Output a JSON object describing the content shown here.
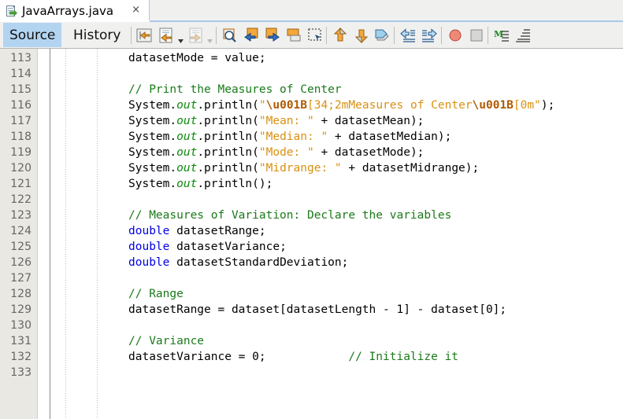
{
  "window": {
    "file_tab": {
      "label": "JavaArrays.java",
      "icon": "java-file-icon",
      "close_label": "×"
    }
  },
  "view_tabs": [
    {
      "id": "source",
      "label": "Source",
      "active": true
    },
    {
      "id": "history",
      "label": "History",
      "active": false
    }
  ],
  "toolbar": {
    "buttons": [
      {
        "name": "last-edit-position-icon",
        "title": "Last Edit Position"
      },
      {
        "name": "back-navigation-icon",
        "title": "Back"
      },
      {
        "name": "forward-navigation-icon",
        "title": "Forward"
      },
      {
        "name": "find-selection-icon",
        "title": "Find Selection"
      },
      {
        "name": "find-previous-icon",
        "title": "Find Previous Occurrence"
      },
      {
        "name": "find-next-icon",
        "title": "Find Next Occurrence"
      },
      {
        "name": "toggle-highlight-icon",
        "title": "Toggle Highlight Search"
      },
      {
        "name": "toggle-rectangular-selection-icon",
        "title": "Toggle Rectangular Selection"
      },
      {
        "name": "previous-bookmark-icon",
        "title": "Previous Bookmark"
      },
      {
        "name": "next-bookmark-icon",
        "title": "Next Bookmark"
      },
      {
        "name": "toggle-bookmark-icon",
        "title": "Toggle Bookmark"
      },
      {
        "name": "shift-line-left-icon",
        "title": "Shift Line Left"
      },
      {
        "name": "shift-line-right-icon",
        "title": "Shift Line Right"
      },
      {
        "name": "toggle-breakpoint-icon",
        "title": "Toggle Breakpoint"
      },
      {
        "name": "stop-icon",
        "title": "Stop"
      },
      {
        "name": "inspect-members-icon",
        "title": "Inspect Members"
      },
      {
        "name": "inspect-hierarchy-icon",
        "title": "Inspect Hierarchy"
      }
    ]
  },
  "editor": {
    "first_line_number": 113,
    "language": "java",
    "colors": {
      "keyword": "#0000e6",
      "comment": "#1a7a1a",
      "string": "#d99011",
      "escape": "#b05a00",
      "static_field": "#0c8a0c",
      "plain": "#000000",
      "gutter_bg": "#e9e8e2",
      "editor_bg": "#ffffff",
      "accent": "#b3d4f0"
    },
    "lines": [
      {
        "n": 113,
        "tokens": [
          {
            "t": "plain",
            "s": "            datasetMode = value;"
          }
        ]
      },
      {
        "n": 114,
        "tokens": []
      },
      {
        "n": 115,
        "tokens": [
          {
            "t": "comment",
            "s": "            // Print the Measures of Center"
          }
        ]
      },
      {
        "n": 116,
        "tokens": [
          {
            "t": "plain",
            "s": "            System."
          },
          {
            "t": "field",
            "s": "out"
          },
          {
            "t": "plain",
            "s": ".println("
          },
          {
            "t": "string",
            "s": "\""
          },
          {
            "t": "escape",
            "s": "\\u001B"
          },
          {
            "t": "string",
            "s": "[34;2mMeasures of Center"
          },
          {
            "t": "escape",
            "s": "\\u001B"
          },
          {
            "t": "string",
            "s": "[0m\""
          },
          {
            "t": "plain",
            "s": ");"
          }
        ]
      },
      {
        "n": 117,
        "tokens": [
          {
            "t": "plain",
            "s": "            System."
          },
          {
            "t": "field",
            "s": "out"
          },
          {
            "t": "plain",
            "s": ".println("
          },
          {
            "t": "string",
            "s": "\"Mean: \""
          },
          {
            "t": "plain",
            "s": " + datasetMean);"
          }
        ]
      },
      {
        "n": 118,
        "tokens": [
          {
            "t": "plain",
            "s": "            System."
          },
          {
            "t": "field",
            "s": "out"
          },
          {
            "t": "plain",
            "s": ".println("
          },
          {
            "t": "string",
            "s": "\"Median: \""
          },
          {
            "t": "plain",
            "s": " + datasetMedian);"
          }
        ]
      },
      {
        "n": 119,
        "tokens": [
          {
            "t": "plain",
            "s": "            System."
          },
          {
            "t": "field",
            "s": "out"
          },
          {
            "t": "plain",
            "s": ".println("
          },
          {
            "t": "string",
            "s": "\"Mode: \""
          },
          {
            "t": "plain",
            "s": " + datasetMode);"
          }
        ]
      },
      {
        "n": 120,
        "tokens": [
          {
            "t": "plain",
            "s": "            System."
          },
          {
            "t": "field",
            "s": "out"
          },
          {
            "t": "plain",
            "s": ".println("
          },
          {
            "t": "string",
            "s": "\"Midrange: \""
          },
          {
            "t": "plain",
            "s": " + datasetMidrange);"
          }
        ]
      },
      {
        "n": 121,
        "tokens": [
          {
            "t": "plain",
            "s": "            System."
          },
          {
            "t": "field",
            "s": "out"
          },
          {
            "t": "plain",
            "s": ".println();"
          }
        ]
      },
      {
        "n": 122,
        "tokens": []
      },
      {
        "n": 123,
        "tokens": [
          {
            "t": "comment",
            "s": "            // Measures of Variation: Declare the variables"
          }
        ]
      },
      {
        "n": 124,
        "tokens": [
          {
            "t": "keyword",
            "s": "            double"
          },
          {
            "t": "plain",
            "s": " datasetRange;"
          }
        ]
      },
      {
        "n": 125,
        "tokens": [
          {
            "t": "keyword",
            "s": "            double"
          },
          {
            "t": "plain",
            "s": " datasetVariance;"
          }
        ]
      },
      {
        "n": 126,
        "tokens": [
          {
            "t": "keyword",
            "s": "            double"
          },
          {
            "t": "plain",
            "s": " datasetStandardDeviation;"
          }
        ]
      },
      {
        "n": 127,
        "tokens": []
      },
      {
        "n": 128,
        "tokens": [
          {
            "t": "comment",
            "s": "            // Range"
          }
        ]
      },
      {
        "n": 129,
        "tokens": [
          {
            "t": "plain",
            "s": "            datasetRange = dataset[datasetLength - 1] - dataset[0];"
          }
        ]
      },
      {
        "n": 130,
        "tokens": []
      },
      {
        "n": 131,
        "tokens": [
          {
            "t": "comment",
            "s": "            // Variance"
          }
        ]
      },
      {
        "n": 132,
        "tokens": [
          {
            "t": "plain",
            "s": "            datasetVariance = 0;            "
          },
          {
            "t": "comment",
            "s": "// Initialize it"
          }
        ]
      },
      {
        "n": 133,
        "tokens": []
      }
    ]
  }
}
